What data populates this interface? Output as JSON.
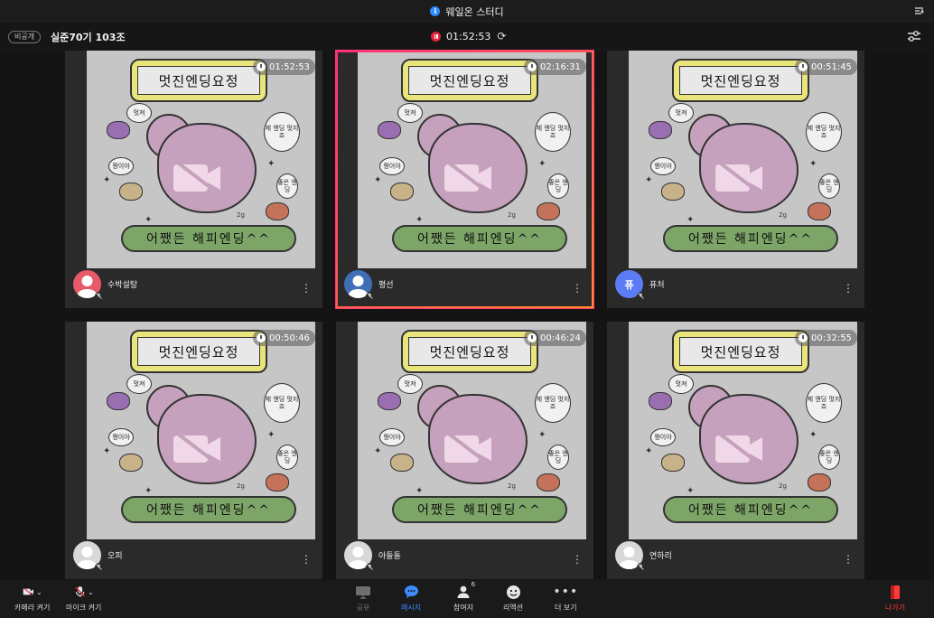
{
  "window": {
    "title": "웨일온 스터디"
  },
  "header": {
    "privacy_label": "비공개",
    "room_name": "실준70기 103조",
    "recording_time": "01:52:53"
  },
  "poster": {
    "title": "멋진엔딩요정",
    "banner": "어쨌든 해피엔딩^^",
    "bubble_left": "멋져",
    "bubble_right": "제 엔딩 멋지죠",
    "bubble_small_left": "짱이야",
    "bubble_small_right": "좋은 엔딩",
    "note": "2g"
  },
  "participants": [
    {
      "name": "수박설탕",
      "timer": "01:52:53",
      "avatar_text": "",
      "avatar_color": "#e85a6a"
    },
    {
      "name": "평선",
      "timer": "02:16:31",
      "avatar_text": "",
      "avatar_color": "#3f6fb5"
    },
    {
      "name": "퓨처",
      "timer": "00:51:45",
      "avatar_text": "퓨",
      "avatar_color": "#5b7cf5"
    },
    {
      "name": "오피",
      "timer": "00:50:46",
      "avatar_text": "",
      "avatar_color": "#d8d8d8"
    },
    {
      "name": "아들돌",
      "timer": "00:46:24",
      "avatar_text": "",
      "avatar_color": "#d8d8d8"
    },
    {
      "name": "연하리",
      "timer": "00:32:55",
      "avatar_text": "",
      "avatar_color": "#d8d8d8"
    }
  ],
  "toolbar": {
    "camera_label": "카메라 켜기",
    "mic_label": "마이크 켜기",
    "share_label": "공유",
    "message_label": "메시지",
    "participants_label": "참여자",
    "participants_count": "6",
    "reaction_label": "리액션",
    "more_label": "더 보기",
    "leave_label": "나가기"
  },
  "colors": {
    "accent_blue": "#3d8bff",
    "record_red": "#e0253b",
    "leave_red": "#ff3b3b",
    "active_border": "#ff3d6e"
  }
}
